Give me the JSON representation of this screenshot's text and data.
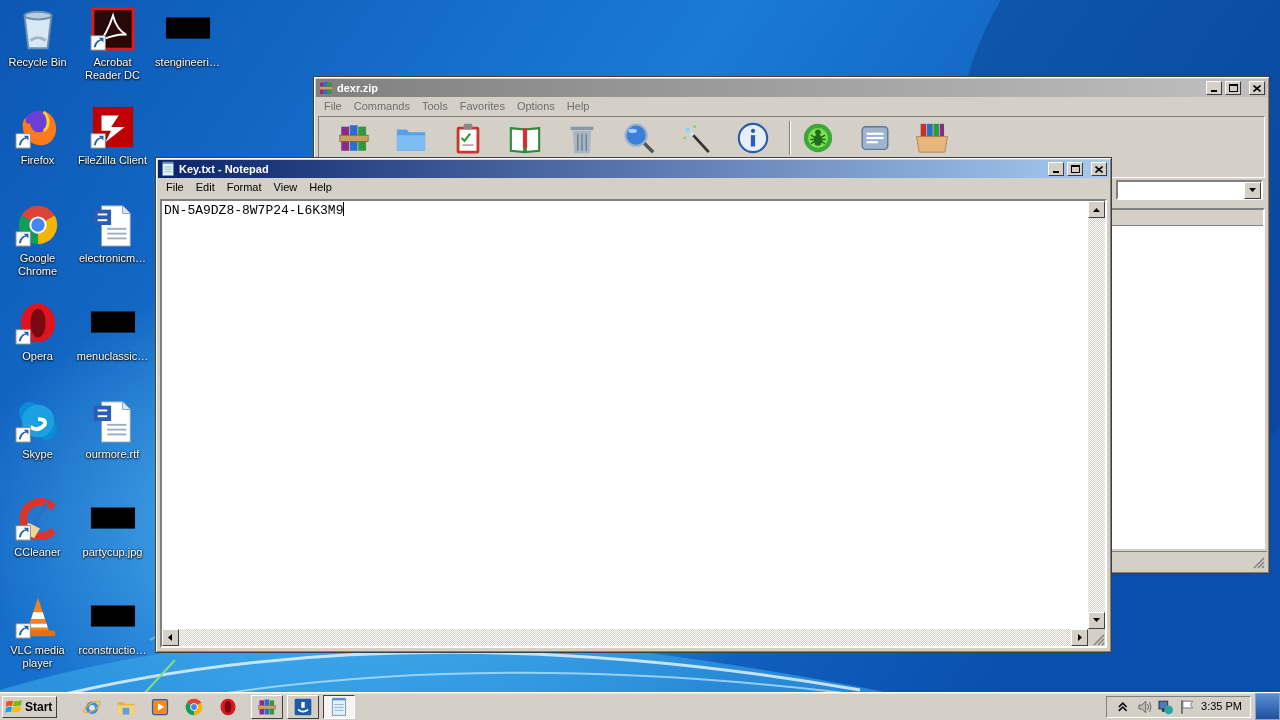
{
  "desktop_icons": [
    {
      "label": "Recycle Bin",
      "kind": "recycle",
      "shortcut": false
    },
    {
      "label": "Firefox",
      "kind": "firefox",
      "shortcut": true
    },
    {
      "label": "Google Chrome",
      "kind": "chrome",
      "shortcut": true
    },
    {
      "label": "Opera",
      "kind": "opera",
      "shortcut": true
    },
    {
      "label": "Skype",
      "kind": "skype",
      "shortcut": true
    },
    {
      "label": "CCleaner",
      "kind": "ccleaner",
      "shortcut": true
    },
    {
      "label": "VLC media player",
      "kind": "vlc",
      "shortcut": true
    },
    {
      "label": "Acrobat Reader DC",
      "kind": "acrobat",
      "shortcut": true
    },
    {
      "label": "FileZilla Client",
      "kind": "filezilla",
      "shortcut": true
    },
    {
      "label": "electronicm…",
      "kind": "word",
      "shortcut": false
    },
    {
      "label": "menuclassic…",
      "kind": "redacted",
      "shortcut": false
    },
    {
      "label": "ourmore.rtf",
      "kind": "word",
      "shortcut": false
    },
    {
      "label": "partycup.jpg",
      "kind": "redacted",
      "shortcut": false
    },
    {
      "label": "rconstructio…",
      "kind": "redacted",
      "shortcut": false
    },
    {
      "label": "stengineeri…",
      "kind": "redacted",
      "shortcut": false
    }
  ],
  "windows": [
    {
      "kind": "winrar",
      "title": "dexr.zip",
      "active": false,
      "menu": [
        "File",
        "Commands",
        "Tools",
        "Favorites",
        "Options",
        "Help"
      ],
      "toolbar": [
        {
          "kind": "add",
          "separator_before": false
        },
        {
          "kind": "extract",
          "separator_before": false
        },
        {
          "kind": "test",
          "separator_before": false
        },
        {
          "kind": "view",
          "separator_before": false
        },
        {
          "kind": "delete",
          "separator_before": false
        },
        {
          "kind": "find",
          "separator_before": false
        },
        {
          "kind": "wizard",
          "separator_before": false
        },
        {
          "kind": "info",
          "separator_before": false
        },
        {
          "kind": "virus",
          "separator_before": true
        },
        {
          "kind": "comment",
          "separator_before": false
        },
        {
          "kind": "sfx",
          "separator_before": false
        }
      ]
    },
    {
      "kind": "notepad",
      "title": "Key.txt - Notepad",
      "active": true,
      "menu": [
        "File",
        "Edit",
        "Format",
        "View",
        "Help"
      ],
      "text": "DN-5A9DZ8-8W7P24-L6K3M9"
    }
  ],
  "taskbar": {
    "start_label": "Start",
    "quick_launch": [
      {
        "kind": "ie"
      },
      {
        "kind": "folder"
      },
      {
        "kind": "media"
      },
      {
        "kind": "chrome"
      },
      {
        "kind": "opera"
      }
    ],
    "tasks": [
      {
        "kind": "winrar",
        "selected": false
      },
      {
        "kind": "remote",
        "selected": false
      },
      {
        "kind": "notepad",
        "selected": true
      }
    ],
    "clock": "3:35 PM"
  }
}
